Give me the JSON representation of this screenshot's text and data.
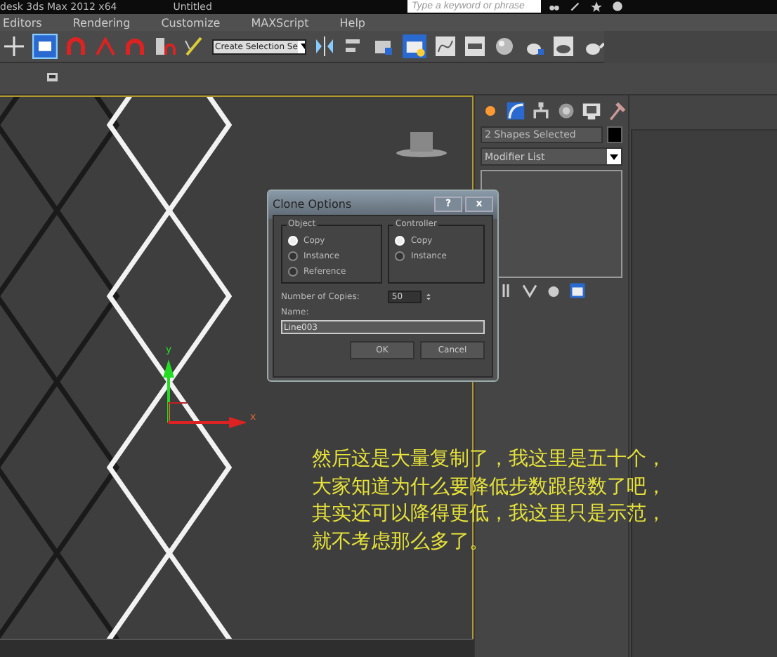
{
  "window": {
    "app_title": "desk 3ds Max 2012 x64",
    "document": "Untitled"
  },
  "search": {
    "placeholder": "Type a keyword or phrase"
  },
  "menu": [
    "Editors",
    "Rendering",
    "Customize",
    "MAXScript",
    "Help"
  ],
  "toolbar": {
    "selection_set": "Create Selection Se"
  },
  "viewport": {
    "axis_y": "y",
    "axis_x": "x"
  },
  "command_panel": {
    "object_name": "2 Shapes Selected",
    "modifier_list": "Modifier List"
  },
  "dialog": {
    "title": "Clone Options",
    "help": "?",
    "close": "x",
    "groups": [
      {
        "title": "Object",
        "options": [
          {
            "label": "Copy",
            "selected": true
          },
          {
            "label": "Instance",
            "selected": false
          },
          {
            "label": "Reference",
            "selected": false
          }
        ]
      },
      {
        "title": "Controller",
        "options": [
          {
            "label": "Copy",
            "selected": true
          },
          {
            "label": "Instance",
            "selected": false
          }
        ]
      }
    ],
    "copies": {
      "label": "Number of Copies:",
      "value": "50"
    },
    "name": {
      "label": "Name:",
      "value": "Line003"
    },
    "buttons": [
      "OK",
      "Cancel"
    ]
  },
  "caption": [
    "然后这是大量复制了，我这里是五十个，",
    "大家知道为什么要降低步数跟段数了吧，",
    "其实还可以降得更低，我这里只是示范，",
    "就不考虑那么多了。"
  ]
}
